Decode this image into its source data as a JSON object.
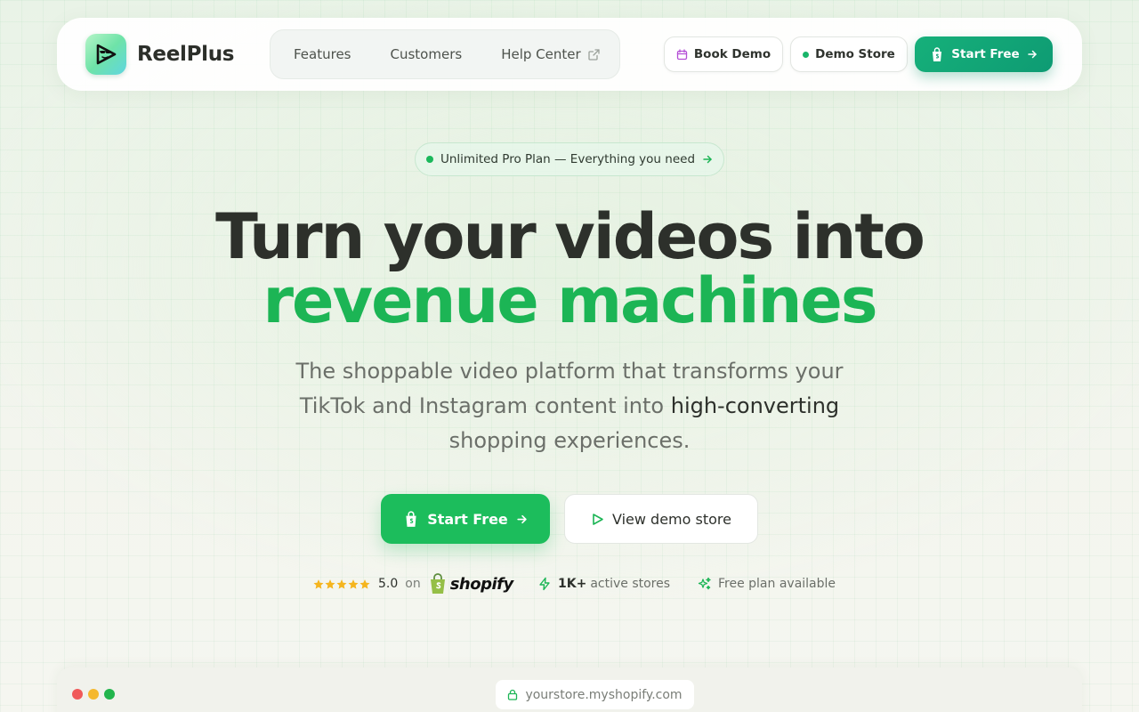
{
  "brand": {
    "name": "ReelPlus"
  },
  "nav": {
    "links": [
      {
        "label": "Features"
      },
      {
        "label": "Customers"
      },
      {
        "label": "Help Center",
        "icon": "external-link-icon"
      }
    ],
    "book_demo": "Book Demo",
    "demo_store": "Demo Store",
    "start_free": "Start Free"
  },
  "badge": {
    "text": "Unlimited Pro Plan — Everything you need"
  },
  "hero": {
    "title_line1": "Turn your videos into",
    "title_line2": "revenue machines",
    "subtitle_before": "The shoppable video platform that transforms your TikTok and Instagram content into ",
    "subtitle_strong": "high-converting",
    "subtitle_after": " shopping experiences.",
    "cta_primary": "Start Free",
    "cta_secondary": "View demo store"
  },
  "trust": {
    "rating": "5.0",
    "rating_on": "on",
    "platform": "shopify",
    "stores_count": "1K+",
    "stores_label": "active stores",
    "free_plan": "Free plan available",
    "stars": 5
  },
  "preview": {
    "url": "yourstore.myshopify.com"
  },
  "colors": {
    "accent_green": "#1cb555",
    "cta_teal": "#0e9b73",
    "text_dark": "#2d302b"
  }
}
